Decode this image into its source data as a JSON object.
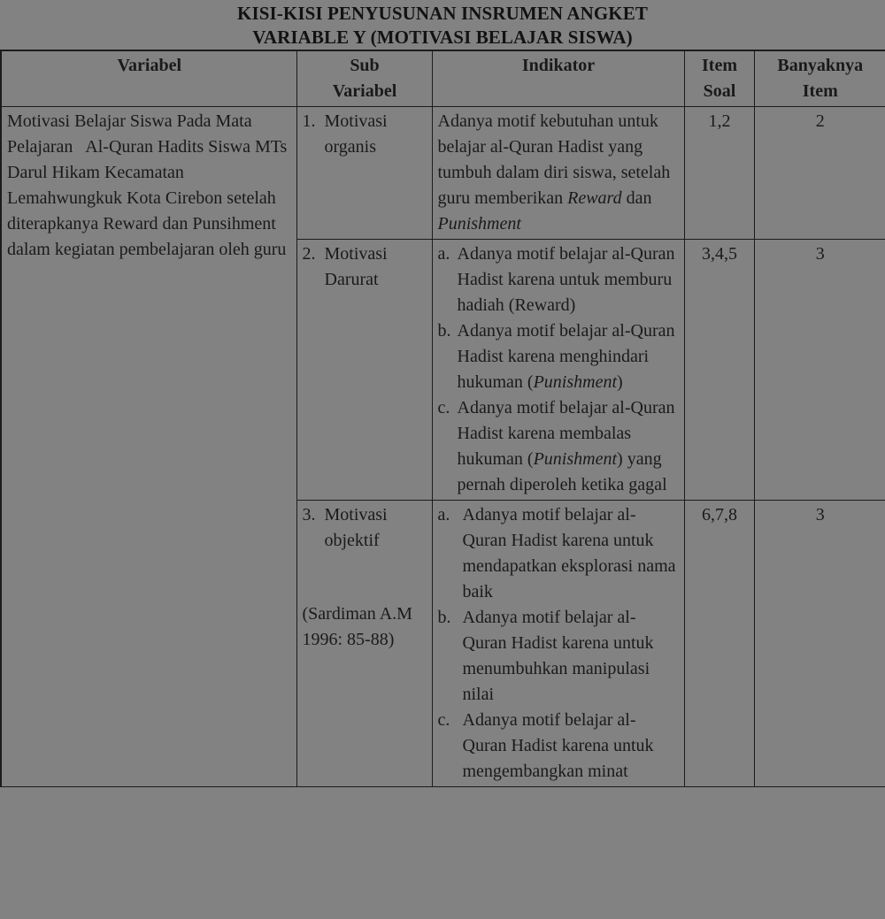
{
  "title": {
    "line1": "KISI-KISI PENYUSUNAN INSRUMEN ANGKET",
    "line2": "VARIABLE Y (MOTIVASI BELAJAR SISWA)"
  },
  "table": {
    "headers": {
      "variabel": "Variabel",
      "sub_variabel_line1": "Sub",
      "sub_variabel_line2": "Variabel",
      "indikator": "Indikator",
      "item_soal_line1": "Item",
      "item_soal_line2": "Soal",
      "banyaknya_item_line1": "Banyaknya",
      "banyaknya_item_line2": "Item"
    },
    "variabel_cell": "Motivasi Belajar Siswa Pada Mata Pelajaran   Al-Quran Hadits Siswa MTs Darul Hikam Kecamatan Lemahwungkuk Kota Cirebon setelah diterapkanya Reward dan Punsihment dalam kegiatan pembelajaran oleh guru",
    "rows": [
      {
        "sub_number": "1.",
        "sub_label": "Motivasi organis",
        "indikator_kind": "plain",
        "indikator_text_a": "Adanya motif kebutuhan untuk belajar al-Quran Hadist yang tumbuh dalam diri siswa, setelah guru memberikan ",
        "indikator_em_1": "Reward",
        "indikator_text_b": " dan ",
        "indikator_em_2": "Punishment",
        "item_soal": "1,2",
        "banyaknya_item": "2"
      },
      {
        "sub_number": "2.",
        "sub_label": "Motivasi Darurat",
        "indikator_kind": "letters",
        "indikator_items": [
          {
            "mark": "a.",
            "text_a": "Adanya motif belajar al-Quran Hadist karena untuk memburu hadiah (Reward)",
            "em": "",
            "text_b": ""
          },
          {
            "mark": "b.",
            "text_a": "Adanya motif belajar al-Quran Hadist karena menghindari hukuman (",
            "em": "Punishment",
            "text_b": ")"
          },
          {
            "mark": "c.",
            "text_a": "Adanya motif belajar al-Quran Hadist karena membalas hukuman (",
            "em": "Punishment",
            "text_b": ") yang pernah diperoleh ketika gagal"
          }
        ],
        "item_soal": "3,4,5",
        "banyaknya_item": "3"
      },
      {
        "sub_number": "3.",
        "sub_label": "Motivasi objektif",
        "sub_source": "(Sardiman A.M 1996: 85-88)",
        "indikator_kind": "letters",
        "indikator_items": [
          {
            "mark": "a.",
            "text_a": "Adanya motif belajar al-Quran Hadist karena untuk mendapatkan eksplorasi nama baik",
            "em": "",
            "text_b": ""
          },
          {
            "mark": "b.",
            "text_a": "Adanya motif belajar al-Quran Hadist karena untuk menumbuhkan manipulasi nilai",
            "em": "",
            "text_b": ""
          },
          {
            "mark": "c.",
            "text_a": "Adanya motif belajar al-Quran Hadist karena untuk mengembangkan minat",
            "em": "",
            "text_b": ""
          }
        ],
        "item_soal": "6,7,8",
        "banyaknya_item": "3"
      }
    ]
  }
}
